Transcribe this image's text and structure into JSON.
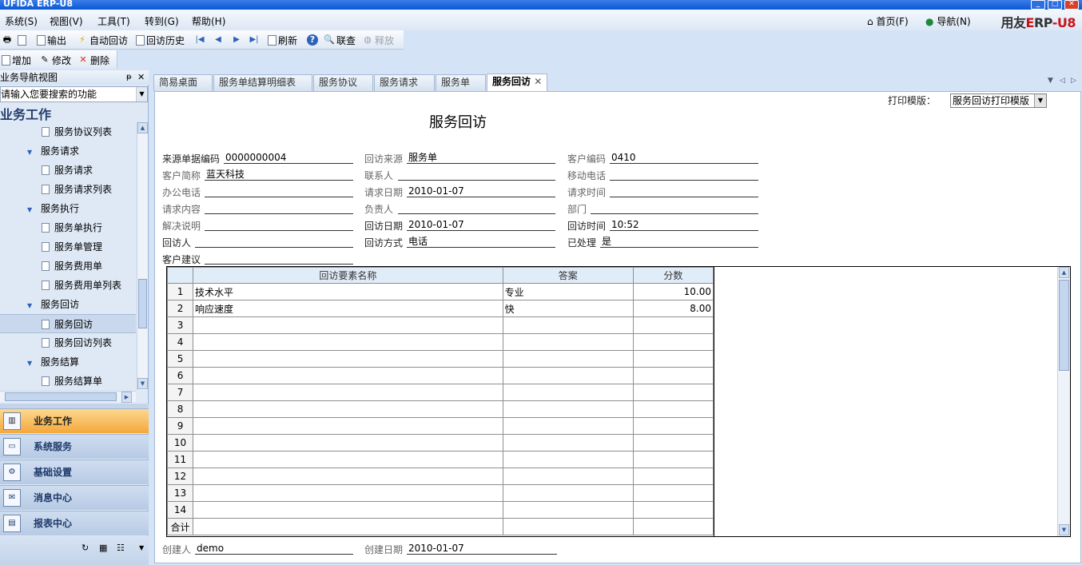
{
  "app": {
    "window_title": "UFIDA ERP-U8",
    "logo_text": "用友ERP-U8"
  },
  "menubar": {
    "items": [
      "系统(S)",
      "视图(V)",
      "工具(T)",
      "转到(G)",
      "帮助(H)"
    ],
    "home_label": "首页(F)",
    "navigate_label": "导航(N)"
  },
  "toolbar1": {
    "output": "输出",
    "auto_visit": "自动回访",
    "visit_history": "回访历史",
    "refresh": "刷新",
    "link_query": "联查",
    "release": "释放"
  },
  "toolbar2": {
    "add": "增加",
    "modify": "修改",
    "delete": "删除"
  },
  "nav": {
    "header": "业务导航视图",
    "search_placeholder": "请输入您要搜索的功能",
    "section": "业务工作",
    "tree": [
      {
        "label": "服务协议列表",
        "level": 2,
        "selected": false
      },
      {
        "label": "服务请求",
        "level": 1,
        "selected": false
      },
      {
        "label": "服务请求",
        "level": 2,
        "selected": false
      },
      {
        "label": "服务请求列表",
        "level": 2,
        "selected": false
      },
      {
        "label": "服务执行",
        "level": 1,
        "selected": false
      },
      {
        "label": "服务单执行",
        "level": 2,
        "selected": false
      },
      {
        "label": "服务单管理",
        "level": 2,
        "selected": false
      },
      {
        "label": "服务费用单",
        "level": 2,
        "selected": false
      },
      {
        "label": "服务费用单列表",
        "level": 2,
        "selected": false
      },
      {
        "label": "服务回访",
        "level": 1,
        "selected": false
      },
      {
        "label": "服务回访",
        "level": 2,
        "selected": true
      },
      {
        "label": "服务回访列表",
        "level": 2,
        "selected": false
      },
      {
        "label": "服务结算",
        "level": 1,
        "selected": false
      },
      {
        "label": "服务结算单",
        "level": 2,
        "selected": false
      }
    ],
    "bottom_buttons": [
      "业务工作",
      "系统服务",
      "基础设置",
      "消息中心",
      "报表中心"
    ]
  },
  "tabs": [
    {
      "label": "简易桌面",
      "active": false
    },
    {
      "label": "服务单结算明细表",
      "active": false
    },
    {
      "label": "服务协议",
      "active": false
    },
    {
      "label": "服务请求",
      "active": false
    },
    {
      "label": "服务单",
      "active": false
    },
    {
      "label": "服务回访",
      "active": true
    }
  ],
  "form": {
    "print_template_label": "打印模版：",
    "print_template_value": "服务回访打印模版",
    "title": "服务回访",
    "fields": {
      "source_no_label": "来源单据编码",
      "source_no": "0000000004",
      "visit_source_label": "回访来源",
      "visit_source": "服务单",
      "customer_code_label": "客户编码",
      "customer_code": "0410",
      "customer_abbr_label": "客户简称",
      "customer_abbr": "蓝天科技",
      "contact_label": "联系人",
      "contact": "",
      "mobile_label": "移动电话",
      "mobile": "",
      "office_phone_label": "办公电话",
      "office_phone": "",
      "request_date_label": "请求日期",
      "request_date": "2010-01-07",
      "request_time_label": "请求时间",
      "request_time": "",
      "request_content_label": "请求内容",
      "request_content": "",
      "owner_label": "负责人",
      "owner": "",
      "dept_label": "部门",
      "dept": "",
      "solution_label": "解决说明",
      "solution": "",
      "visit_date_label": "回访日期",
      "visit_date": "2010-01-07",
      "visit_time_label": "回访时间",
      "visit_time": "10:52",
      "visitor_label": "回访人",
      "visitor": "",
      "visit_method_label": "回访方式",
      "visit_method": "电话",
      "processed_label": "已处理",
      "processed": "是",
      "suggestion_label": "客户建议",
      "suggestion": "",
      "creator_label": "创建人",
      "creator": "demo",
      "create_date_label": "创建日期",
      "create_date": "2010-01-07"
    }
  },
  "grid": {
    "columns": [
      "回访要素名称",
      "答案",
      "分数"
    ],
    "rows": [
      {
        "no": "1",
        "name": "技术水平",
        "answer": "专业",
        "score": "10.00"
      },
      {
        "no": "2",
        "name": "响应速度",
        "answer": "快",
        "score": "8.00"
      },
      {
        "no": "3",
        "name": "",
        "answer": "",
        "score": ""
      },
      {
        "no": "4",
        "name": "",
        "answer": "",
        "score": ""
      },
      {
        "no": "5",
        "name": "",
        "answer": "",
        "score": ""
      },
      {
        "no": "6",
        "name": "",
        "answer": "",
        "score": ""
      },
      {
        "no": "7",
        "name": "",
        "answer": "",
        "score": ""
      },
      {
        "no": "8",
        "name": "",
        "answer": "",
        "score": ""
      },
      {
        "no": "9",
        "name": "",
        "answer": "",
        "score": ""
      },
      {
        "no": "10",
        "name": "",
        "answer": "",
        "score": ""
      },
      {
        "no": "11",
        "name": "",
        "answer": "",
        "score": ""
      },
      {
        "no": "12",
        "name": "",
        "answer": "",
        "score": ""
      },
      {
        "no": "13",
        "name": "",
        "answer": "",
        "score": ""
      },
      {
        "no": "14",
        "name": "",
        "answer": "",
        "score": ""
      }
    ],
    "total_label": "合计"
  }
}
